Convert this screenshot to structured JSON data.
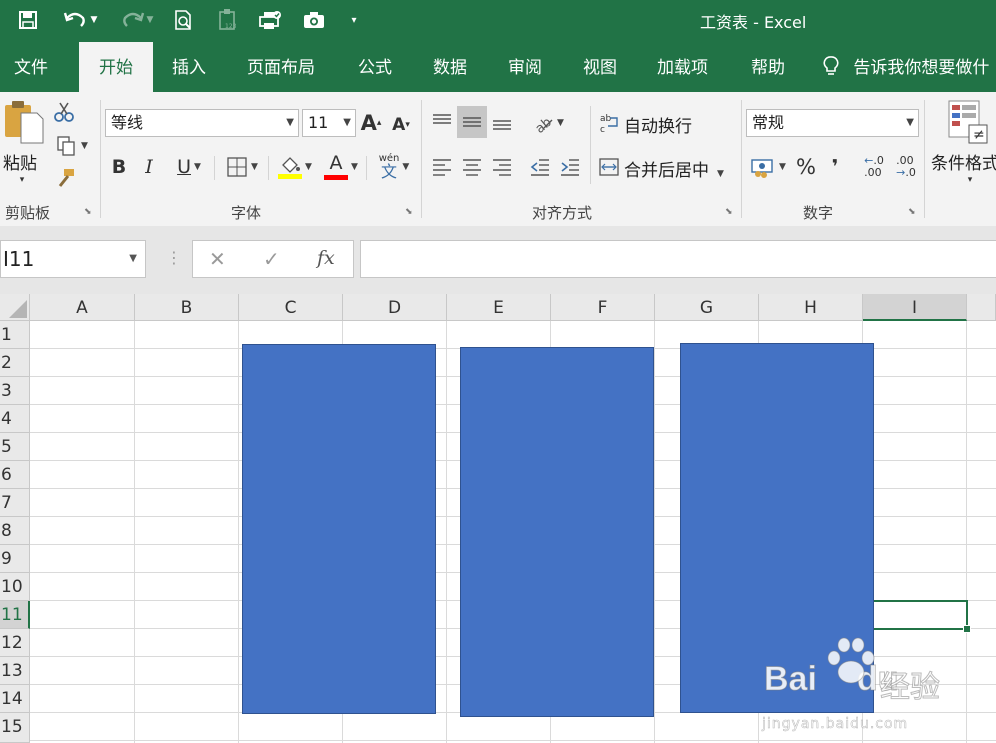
{
  "window": {
    "title": "工资表 - Excel"
  },
  "qat": {
    "save": "save-icon",
    "undo": "undo-icon",
    "redo": "redo-icon",
    "preview": "print-preview-icon",
    "paste_values": "paste-values-icon",
    "quick_print": "quick-print-icon",
    "camera": "camera-icon",
    "customize": "customize-quick-access-icon"
  },
  "tabs": [
    "文件",
    "开始",
    "插入",
    "页面布局",
    "公式",
    "数据",
    "审阅",
    "视图",
    "加载项",
    "帮助"
  ],
  "tell_me": "告诉我你想要做什",
  "ribbon": {
    "clipboard": {
      "paste_label": "粘贴",
      "group_label": "剪贴板"
    },
    "font": {
      "name": "等线",
      "size": "11",
      "grow": "A",
      "shrink": "A",
      "bold": "B",
      "italic": "I",
      "underline": "U",
      "phonetic_top": "wén",
      "phonetic_bottom": "文",
      "group_label": "字体",
      "fill_color": "#ffff00",
      "font_color": "#ff0000"
    },
    "alignment": {
      "wrap_text": "自动换行",
      "merge_center": "合并后居中",
      "group_label": "对齐方式"
    },
    "number": {
      "format": "常规",
      "percent": "%",
      "comma": "❜",
      "inc_decimal": ".0",
      "dec_decimal": ".00",
      "group_label": "数字"
    },
    "styles": {
      "conditional_format": "条件格式"
    }
  },
  "formula_bar": {
    "name_box": "I11",
    "cancel": "✕",
    "enter": "✓",
    "fx": "fx",
    "value": ""
  },
  "sheet": {
    "columns": [
      "A",
      "B",
      "C",
      "D",
      "E",
      "F",
      "G",
      "H",
      "I"
    ],
    "rows": [
      "1",
      "2",
      "3",
      "4",
      "5",
      "6",
      "7",
      "8",
      "9",
      "10",
      "11",
      "12",
      "13",
      "14",
      "15"
    ],
    "selected_cell": "I11",
    "shape_color": "#4472c4"
  },
  "watermark": {
    "brand": "Bai",
    "brand_tail": "du",
    "cn": "经验",
    "url": "jingyan.baidu.com"
  }
}
